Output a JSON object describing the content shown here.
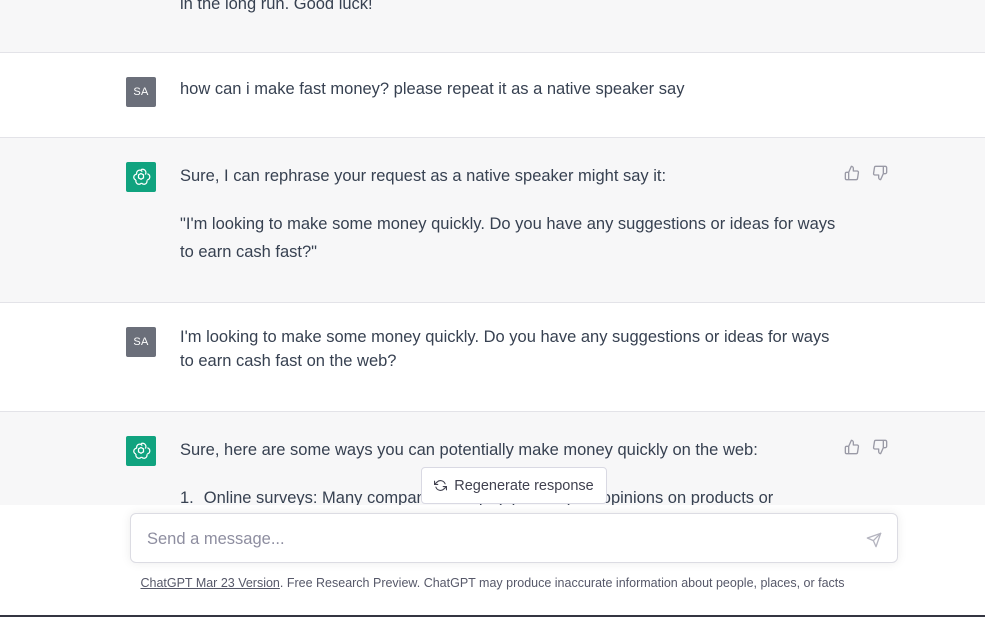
{
  "conversation": {
    "top_fragment": "in the long run. Good luck!",
    "messages": [
      {
        "role": "user",
        "avatar_initials": "SA",
        "text": "how can i make fast money? please repeat it as a native speaker say"
      },
      {
        "role": "assistant",
        "paragraphs": [
          "Sure, I can rephrase your request as a native speaker might say it:",
          "\"I'm looking to make some money quickly. Do you have any suggestions or ideas for ways to earn cash fast?\""
        ]
      },
      {
        "role": "user",
        "avatar_initials": "SA",
        "text": "I'm looking to make some money quickly. Do you have any suggestions or ideas for ways to earn cash fast on the web?"
      },
      {
        "role": "assistant",
        "paragraphs": [
          "Sure, here are some ways you can potentially make money quickly on the web:"
        ],
        "list": [
          {
            "number": "1.",
            "text": "Online surveys: Many companies will pay you for your opinions on products or"
          }
        ]
      }
    ]
  },
  "regenerate_button": {
    "label": "Regenerate response",
    "icon": "refresh-icon"
  },
  "composer": {
    "placeholder": "Send a message...",
    "value": "",
    "send_icon": "paper-plane-icon"
  },
  "footer": {
    "version_link": "ChatGPT Mar 23 Version",
    "disclaimer": ". Free Research Preview. ChatGPT may produce inaccurate information about people, places, or facts"
  },
  "colors": {
    "assistant_bg": "#f7f7f8",
    "user_bg": "#ffffff",
    "bot_avatar": "#10a37f",
    "user_avatar": "#6b6f7a",
    "text": "#374151"
  }
}
